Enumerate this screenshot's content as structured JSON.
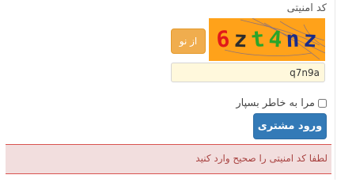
{
  "form": {
    "security_code_label": "کد امنیتی",
    "captcha": {
      "chars": [
        {
          "char": "6",
          "color": "#e11919"
        },
        {
          "char": "z",
          "color": "#2d2d2d"
        },
        {
          "char": "t",
          "color": "#2aa52a"
        },
        {
          "char": "4",
          "color": "#2aa52a"
        },
        {
          "char": "n",
          "color": "#1b2d87"
        },
        {
          "char": "z",
          "color": "#1b2d87"
        }
      ],
      "background_color": "#ffa21a"
    },
    "refresh_button_label": "از نو",
    "captcha_input_value": "q7n9a",
    "remember_me_label": "مرا به خاطر بسپار",
    "remember_me_checked": false,
    "login_button_label": "ورود مشتری",
    "error_message": "لطفا کد امنیتی را صحیح وارد کنید"
  }
}
